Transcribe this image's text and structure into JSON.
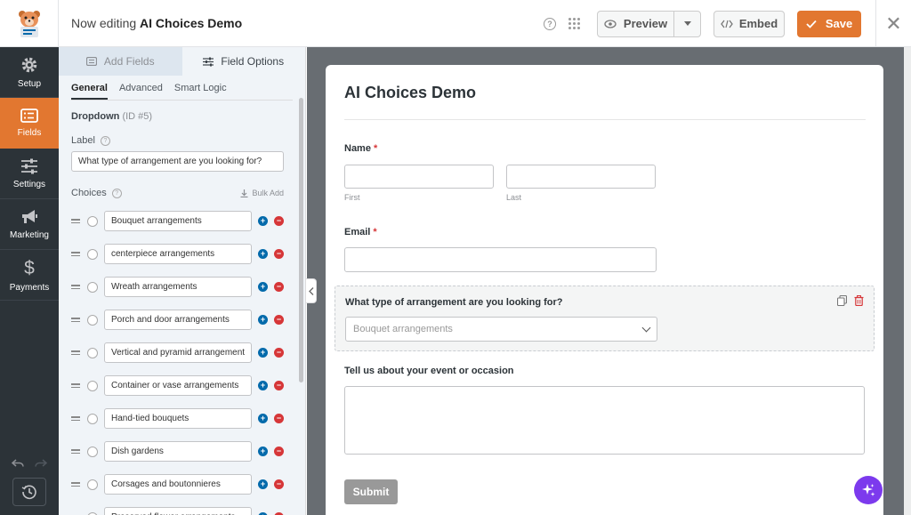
{
  "header": {
    "title_prefix": "Now editing",
    "form_name": "AI Choices Demo",
    "preview_label": "Preview",
    "embed_label": "Embed",
    "save_label": "Save",
    "help_glyph": "?",
    "close_glyph": "✕"
  },
  "nav": {
    "items": [
      {
        "label": "Setup",
        "icon": "gear-icon"
      },
      {
        "label": "Fields",
        "icon": "list-icon"
      },
      {
        "label": "Settings",
        "icon": "sliders-icon"
      },
      {
        "label": "Marketing",
        "icon": "megaphone-icon"
      },
      {
        "label": "Payments",
        "icon": "dollar-icon"
      }
    ],
    "active": "Fields"
  },
  "panel": {
    "tabs": [
      "Add Fields",
      "Field Options"
    ],
    "active_tab": "Field Options",
    "subtabs": [
      "General",
      "Advanced",
      "Smart Logic"
    ],
    "active_subtab": "General",
    "field_type": "Dropdown",
    "field_id": "(ID #5)",
    "label_title": "Label",
    "label_value": "What type of arrangement are you looking for?",
    "choices_title": "Choices",
    "bulk_add_label": "Bulk Add",
    "choices": [
      "Bouquet arrangements",
      "centerpiece arrangements",
      "Wreath arrangements",
      "Porch and door arrangements",
      "Vertical and pyramid arrangement",
      "Container or vase arrangements",
      "Hand-tied bouquets",
      "Dish gardens",
      "Corsages and boutonnieres",
      "Preserved flower arrangements"
    ],
    "add_glyph": "+",
    "remove_glyph": "−",
    "help_glyph": "?"
  },
  "form": {
    "title": "AI Choices Demo",
    "name_label": "Name",
    "first_label": "First",
    "last_label": "Last",
    "email_label": "Email",
    "dropdown_label": "What type of arrangement are you looking for?",
    "dropdown_value": "Bouquet arrangements",
    "textarea_label": "Tell us about your event or occasion",
    "submit_label": "Submit",
    "required_mark": "*"
  },
  "colors": {
    "accent": "#e27730",
    "nav_bg": "#2c3338",
    "canvas_bg": "#686d72",
    "ai_button": "#7c3aed",
    "add": "#036aab",
    "remove": "#d63638"
  }
}
